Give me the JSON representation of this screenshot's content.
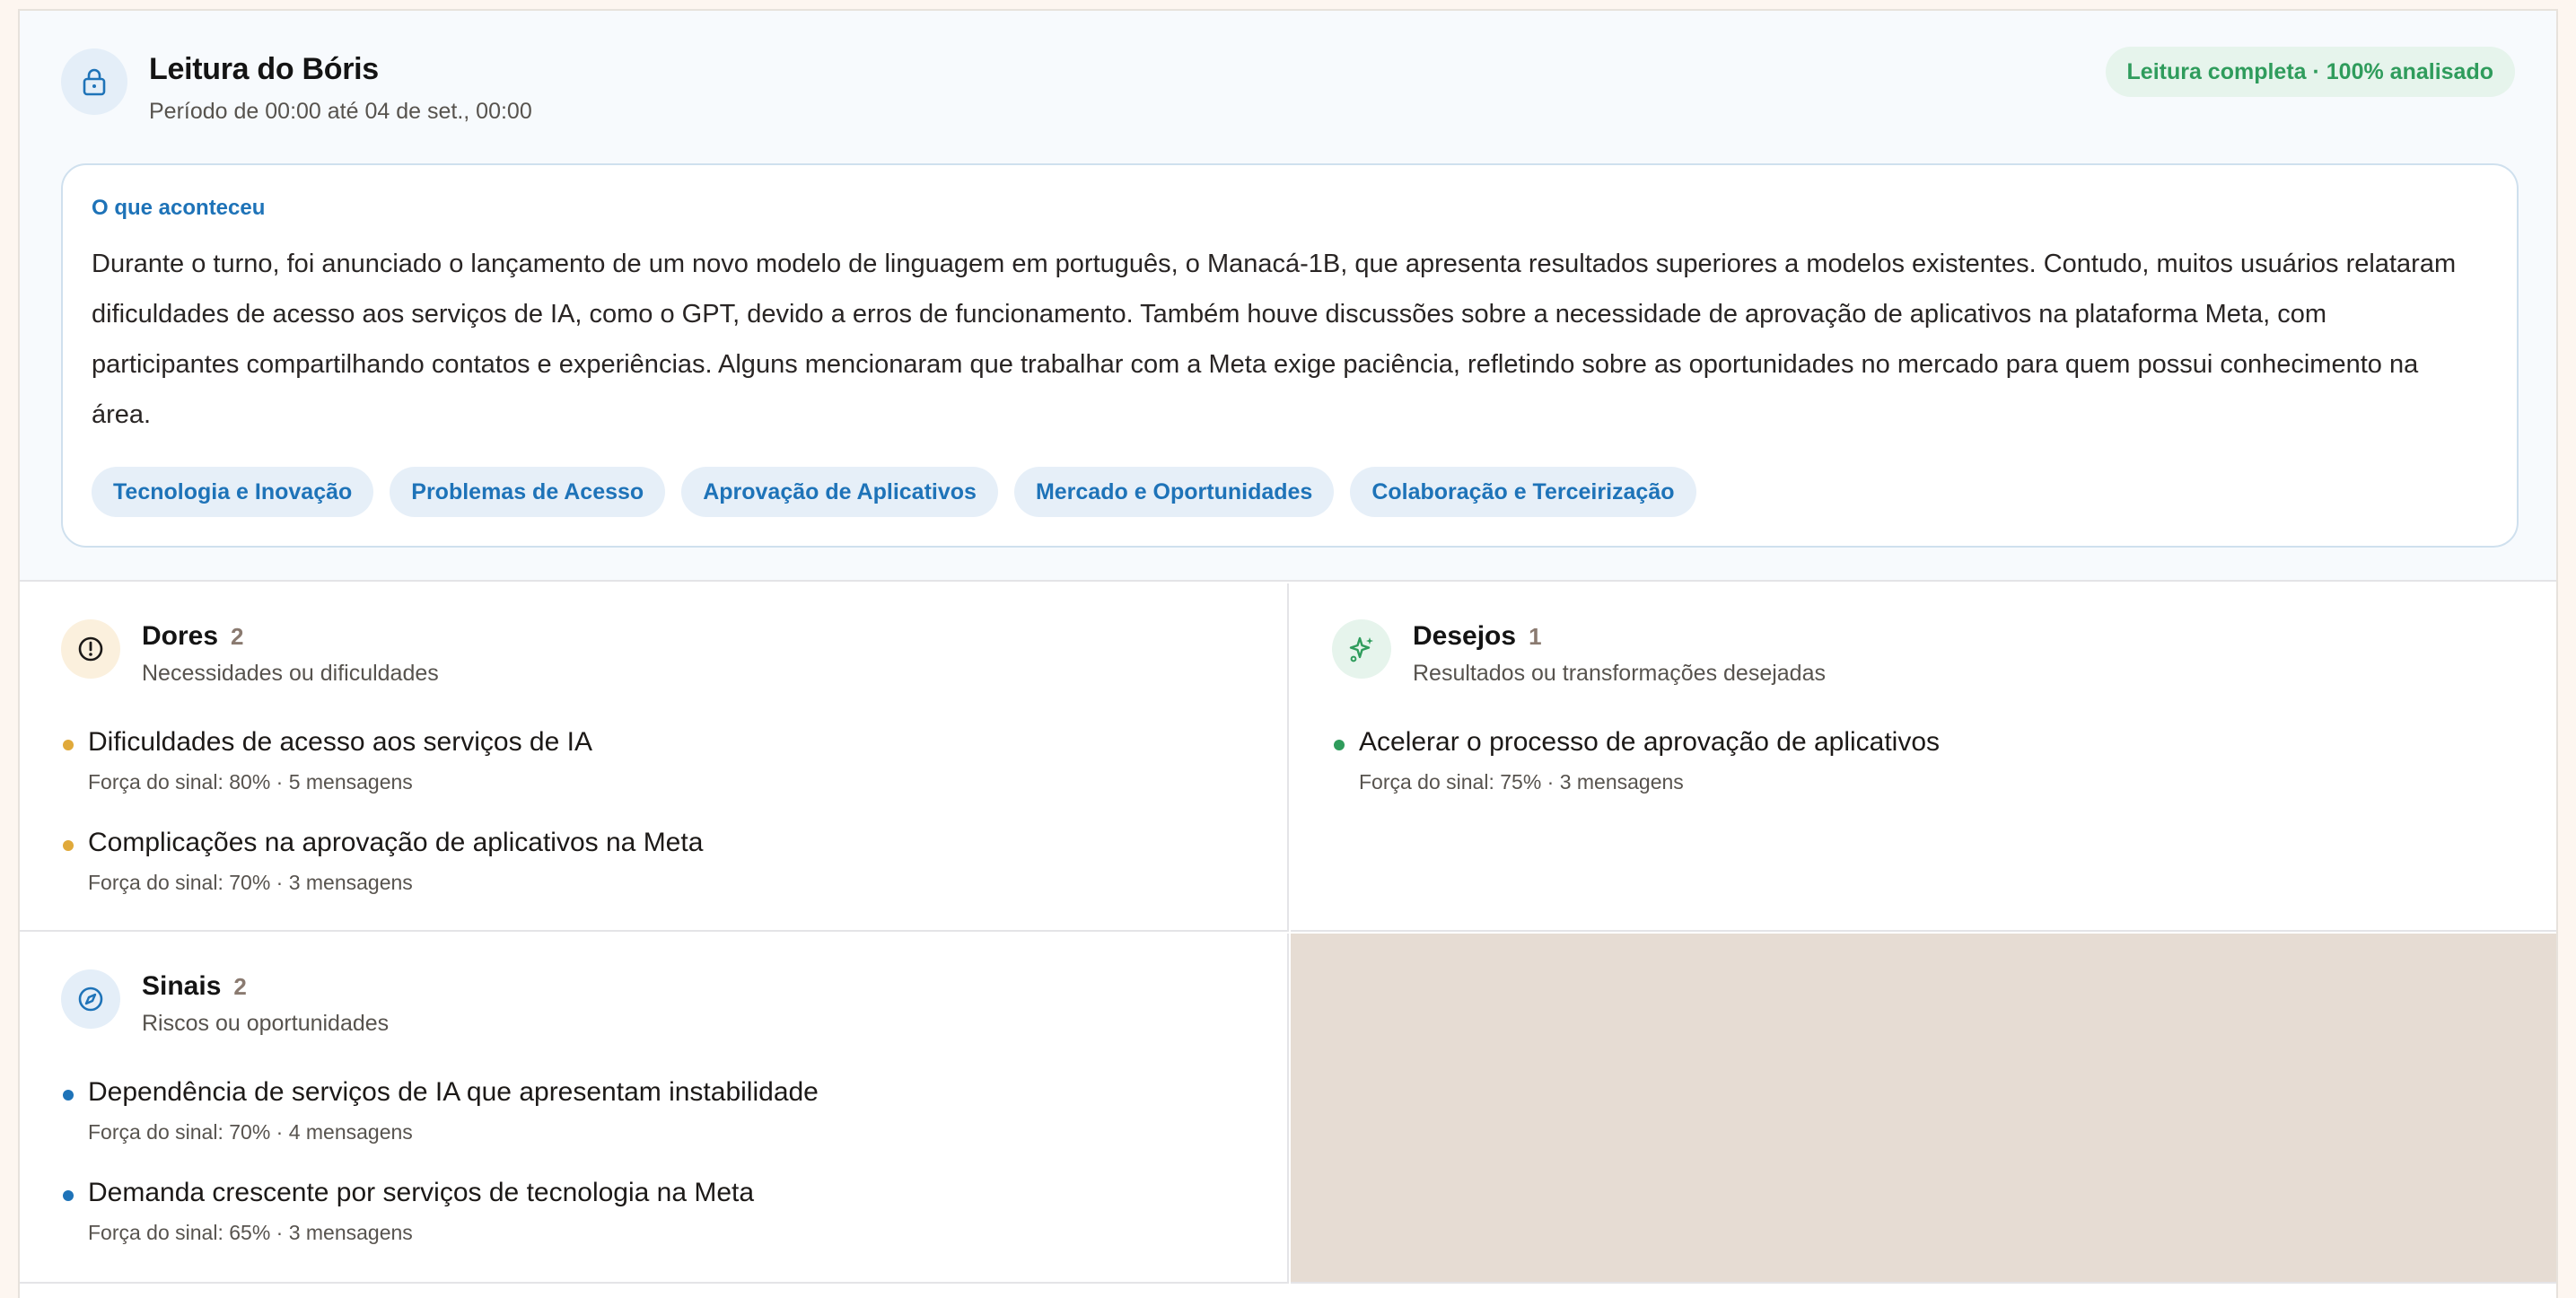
{
  "header": {
    "title": "Leitura do Bóris",
    "period": "Período de 00:00 até 04 de set., 00:00",
    "status": "Leitura completa · 100% analisado",
    "lock_icon": "lock-icon"
  },
  "summary": {
    "label": "O que aconteceu",
    "text": "Durante o turno, foi anunciado o lançamento de um novo modelo de linguagem em português, o Manacá-1B, que apresenta resultados superiores a modelos existentes. Contudo, muitos usuários relataram dificuldades de acesso aos serviços de IA, como o GPT, devido a erros de funcionamento. Também houve discussões sobre a necessidade de aprovação de aplicativos na plataforma Meta, com participantes compartilhando contatos e experiências. Alguns mencionaram que trabalhar com a Meta exige paciência, refletindo sobre as oportunidades no mercado para quem possui conhecimento na área.",
    "tags": [
      "Tecnologia e Inovação",
      "Problemas de Acesso",
      "Aprovação de Aplicativos",
      "Mercado e Oportunidades",
      "Colaboração e Terceirização"
    ]
  },
  "dores": {
    "title": "Dores",
    "count": "2",
    "subtitle": "Necessidades ou dificuldades",
    "icon": "alert-circle-icon",
    "color": "#e0a93a",
    "items": [
      {
        "text": "Dificuldades de acesso aos serviços de IA",
        "meta": "Força do sinal: 80% · 5 mensagens"
      },
      {
        "text": "Complicações na aprovação de aplicativos na Meta",
        "meta": "Força do sinal: 70% · 3 mensagens"
      }
    ]
  },
  "desejos": {
    "title": "Desejos",
    "count": "1",
    "subtitle": "Resultados ou transformações desejadas",
    "icon": "sparkles-icon",
    "color": "#2f9c5c",
    "items": [
      {
        "text": "Acelerar o processo de aprovação de aplicativos",
        "meta": "Força do sinal: 75% · 3 mensagens"
      }
    ]
  },
  "sinais": {
    "title": "Sinais",
    "count": "2",
    "subtitle": "Riscos ou oportunidades",
    "icon": "compass-icon",
    "color": "#1e73b8",
    "items": [
      {
        "text": "Dependência de serviços de IA que apresentam instabilidade",
        "meta": "Força do sinal: 70% · 4 mensagens"
      },
      {
        "text": "Demanda crescente por serviços de tecnologia na Meta",
        "meta": "Força do sinal: 65% · 3 mensagens"
      }
    ]
  }
}
